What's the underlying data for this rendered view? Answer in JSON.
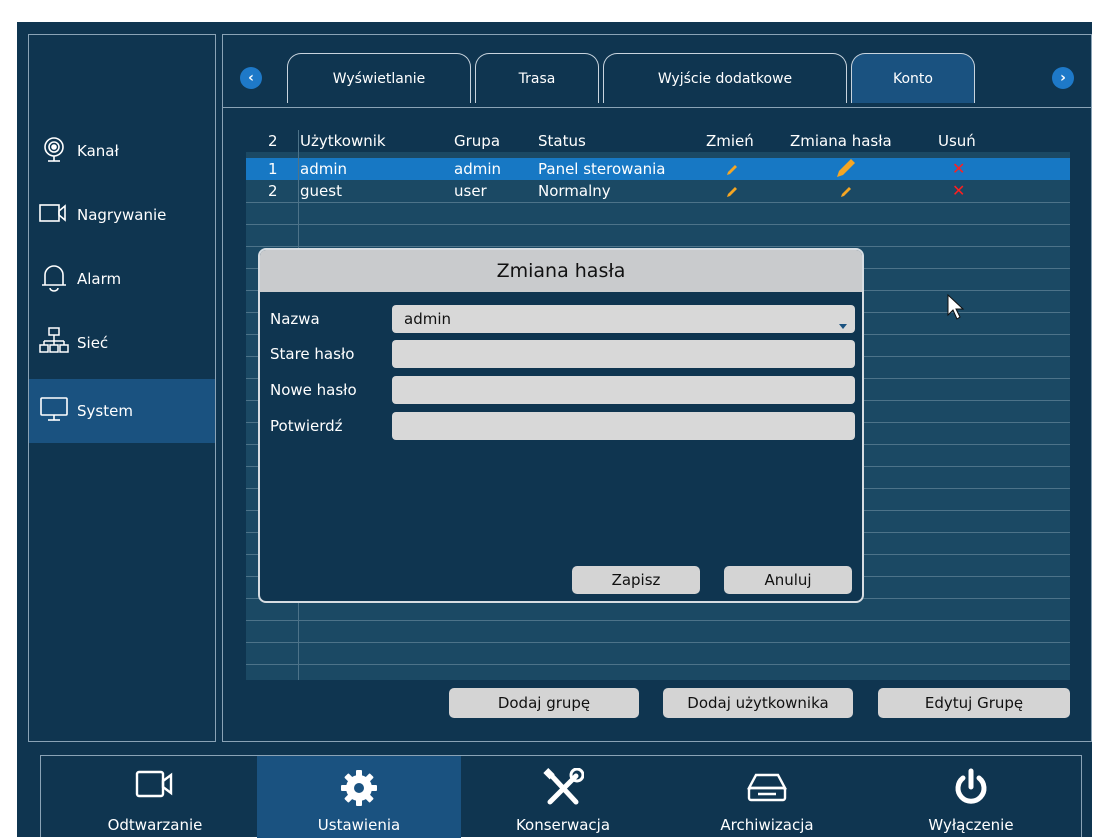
{
  "sidebar": {
    "items": [
      {
        "label": "Kanał",
        "icon": "camera-lens-icon"
      },
      {
        "label": "Nagrywanie",
        "icon": "video-camera-icon"
      },
      {
        "label": "Alarm",
        "icon": "bell-icon"
      },
      {
        "label": "Sieć",
        "icon": "network-icon"
      },
      {
        "label": "System",
        "icon": "monitor-icon",
        "active": true
      }
    ]
  },
  "tabs": {
    "prev_glyph": "‹",
    "next_glyph": "›",
    "items": [
      {
        "label": "Wyświetlanie"
      },
      {
        "label": "Trasa"
      },
      {
        "label": "Wyjście dodatkowe"
      },
      {
        "label": "Konto",
        "active": true
      }
    ]
  },
  "users_table": {
    "headers": [
      "2",
      "Użytkownik",
      "Grupa",
      "Status",
      "Zmień",
      "Zmiana hasła",
      "Usuń"
    ],
    "rows": [
      {
        "num": "1",
        "user": "admin",
        "group": "admin",
        "status": "Panel sterowania",
        "selected": true
      },
      {
        "num": "2",
        "user": "guest",
        "group": "user",
        "status": "Normalny",
        "selected": false
      }
    ],
    "delete_glyph": "✕"
  },
  "table_buttons": {
    "add_group": "Dodaj grupę",
    "add_user": "Dodaj użytkownika",
    "edit_group": "Edytuj Grupę"
  },
  "dialog": {
    "title": "Zmiana hasła",
    "name_label": "Nazwa",
    "name_value": "admin",
    "old_label": "Stare hasło",
    "new_label": "Nowe hasło",
    "confirm_label": "Potwierdź",
    "save": "Zapisz",
    "cancel": "Anuluj"
  },
  "bottombar": {
    "items": [
      {
        "label": "Odtwarzanie",
        "icon": "playback-camera-icon"
      },
      {
        "label": "Ustawienia",
        "icon": "gear-icon",
        "active": true
      },
      {
        "label": "Konserwacja",
        "icon": "tools-icon"
      },
      {
        "label": "Archiwizacja",
        "icon": "drive-icon"
      },
      {
        "label": "Wyłączenie",
        "icon": "power-icon"
      }
    ]
  },
  "colors": {
    "background": "#0f3550",
    "active": "#1a5280",
    "selected_row": "#1778c4",
    "pencil": "#f5a623",
    "delete": "#ff1f1f",
    "nav_button": "#1e79c8"
  }
}
